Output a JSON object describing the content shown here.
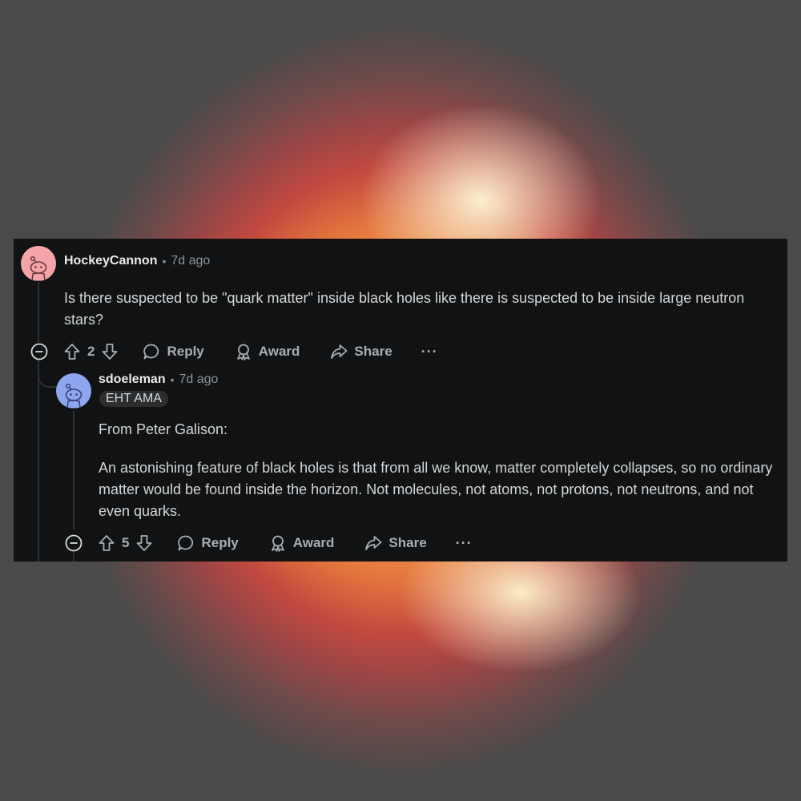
{
  "comments": [
    {
      "username": "HockeyCannon",
      "separator": "•",
      "time": "7d ago",
      "body": "Is there suspected to be \"quark matter\" inside black holes like there is suspected to be inside large neutron stars?",
      "votes": "2",
      "avatar_color": "#f4a3a8",
      "actions": {
        "reply": "Reply",
        "award": "Award",
        "share": "Share",
        "more": "···"
      }
    },
    {
      "username": "sdoeleman",
      "separator": "•",
      "time": "7d ago",
      "flair": "EHT AMA",
      "body_1": "From Peter Galison:",
      "body_2": "An astonishing feature of black holes is that from all we know, matter completely collapses, so no ordinary matter would be found inside the horizon. Not molecules, not atoms, not protons, not neutrons, and not even quarks.",
      "votes": "5",
      "avatar_color": "#8fa6ef",
      "actions": {
        "reply": "Reply",
        "award": "Award",
        "share": "Share",
        "more": "···"
      }
    }
  ],
  "colors": {
    "panel_bg": "#111213",
    "text": "#d3d6d8",
    "muted": "#8c9296"
  }
}
